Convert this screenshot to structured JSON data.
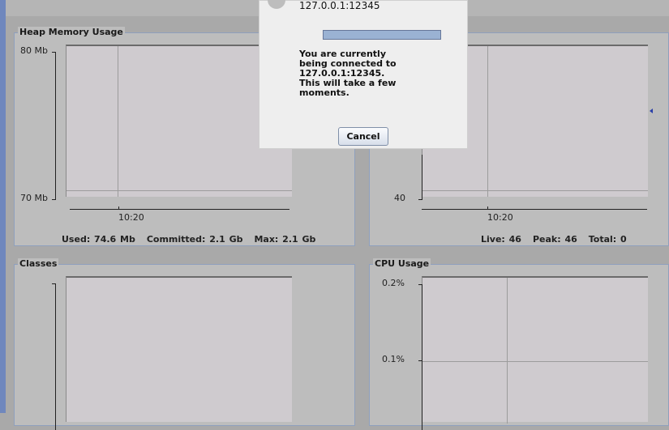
{
  "panels": {
    "heap": {
      "title": "Heap Memory Usage",
      "y_top": "80 Mb",
      "y_bottom": "70 Mb",
      "x_tick": "10:20",
      "used": "Used: 74.6 Mb",
      "committed": "Committed: 2.1 Gb",
      "max": "Max: 2.1 Gb"
    },
    "threads": {
      "y_bottom": "40",
      "x_tick": "10:20",
      "live": "Live: 46",
      "peak": "Peak: 46",
      "total": "Total: 0"
    },
    "classes": {
      "title": "Classes"
    },
    "cpu": {
      "title": "CPU Usage",
      "y_top": "0.2%",
      "y_mid": "0.1%"
    }
  },
  "dialog": {
    "address": "127.0.0.1:12345",
    "message": "You are currently being connected to 127.0.0.1:12345. This will take a few moments.",
    "cancel_label": "Cancel",
    "progress": 1.0
  }
}
